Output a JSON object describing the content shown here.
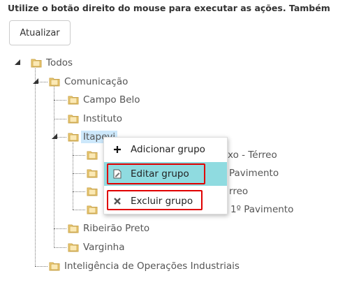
{
  "instruction": "Utilize o botão direito do mouse para executar as ações. Também",
  "toolbar": {
    "refresh_label": "Atualizar"
  },
  "tree": {
    "root": "Todos",
    "comunicacao": "Comunicação",
    "campo_belo": "Campo Belo",
    "instituto": "Instituto",
    "itapevi": "Itapevi",
    "itapevi_children": [
      "aixo - Térreo",
      "Pavimento",
      "rreo",
      "1º Pavimento"
    ],
    "ribeirao_preto": "Ribeirão Preto",
    "varginha": "Varginha",
    "inteligencia": "Inteligência de Operações Industriais"
  },
  "context_menu": {
    "add": "Adicionar grupo",
    "edit": "Editar grupo",
    "delete": "Excluir grupo"
  },
  "colors": {
    "folder_fill": "#f3d27a",
    "folder_stroke": "#c9a34a",
    "selection": "#cde8fb",
    "menu_active": "#8fdbe0",
    "highlight_box": "#e00000"
  }
}
